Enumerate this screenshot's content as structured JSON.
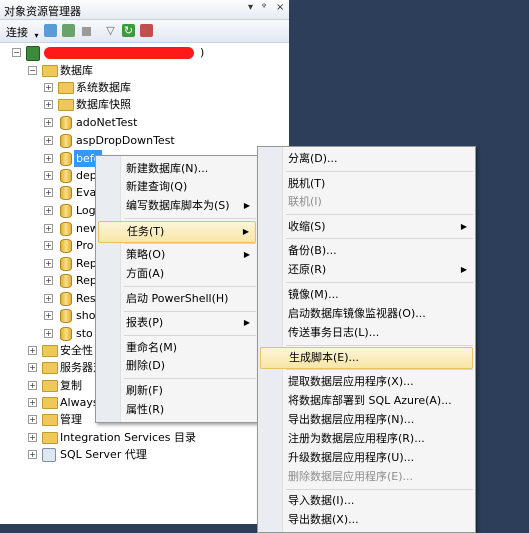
{
  "panel": {
    "title": "对象资源管理器",
    "controls": {
      "dropdown": "▾",
      "pin": "ᵠ",
      "close": "×"
    },
    "toolbar": {
      "connect_label": "连接"
    }
  },
  "tree": {
    "server_suffix": ")",
    "databases_folder": "数据库",
    "db_children": [
      "系统数据库",
      "数据库快照",
      "adoNetTest",
      "aspDropDownTest",
      "befo",
      "dep",
      "Eva",
      "Log",
      "new",
      "Pro",
      "Rep",
      "Rep",
      "Res",
      "sho",
      "sto"
    ],
    "server_nodes": [
      "安全性",
      "服务器对",
      "复制",
      "Always",
      "管理",
      "Integration Services 目录",
      "SQL Server 代理"
    ]
  },
  "context_menu": {
    "items": [
      "新建数据库(N)...",
      "新建查询(Q)",
      "编写数据库脚本为(S)",
      "任务(T)",
      "策略(O)",
      "方面(A)",
      "启动 PowerShell(H)",
      "报表(P)",
      "重命名(M)",
      "删除(D)",
      "刷新(F)",
      "属性(R)"
    ]
  },
  "tasks_menu": {
    "items": [
      "分离(D)...",
      "脱机(T)",
      "联机(I)",
      "收缩(S)",
      "备份(B)...",
      "还原(R)",
      "镜像(M)...",
      "启动数据库镜像监视器(O)...",
      "传送事务日志(L)...",
      "生成脚本(E)...",
      "提取数据层应用程序(X)...",
      "将数据库部署到 SQL Azure(A)...",
      "导出数据层应用程序(N)...",
      "注册为数据层应用程序(R)...",
      "升级数据层应用程序(U)...",
      "删除数据层应用程序(E)...",
      "导入数据(I)...",
      "导出数据(X)..."
    ]
  }
}
